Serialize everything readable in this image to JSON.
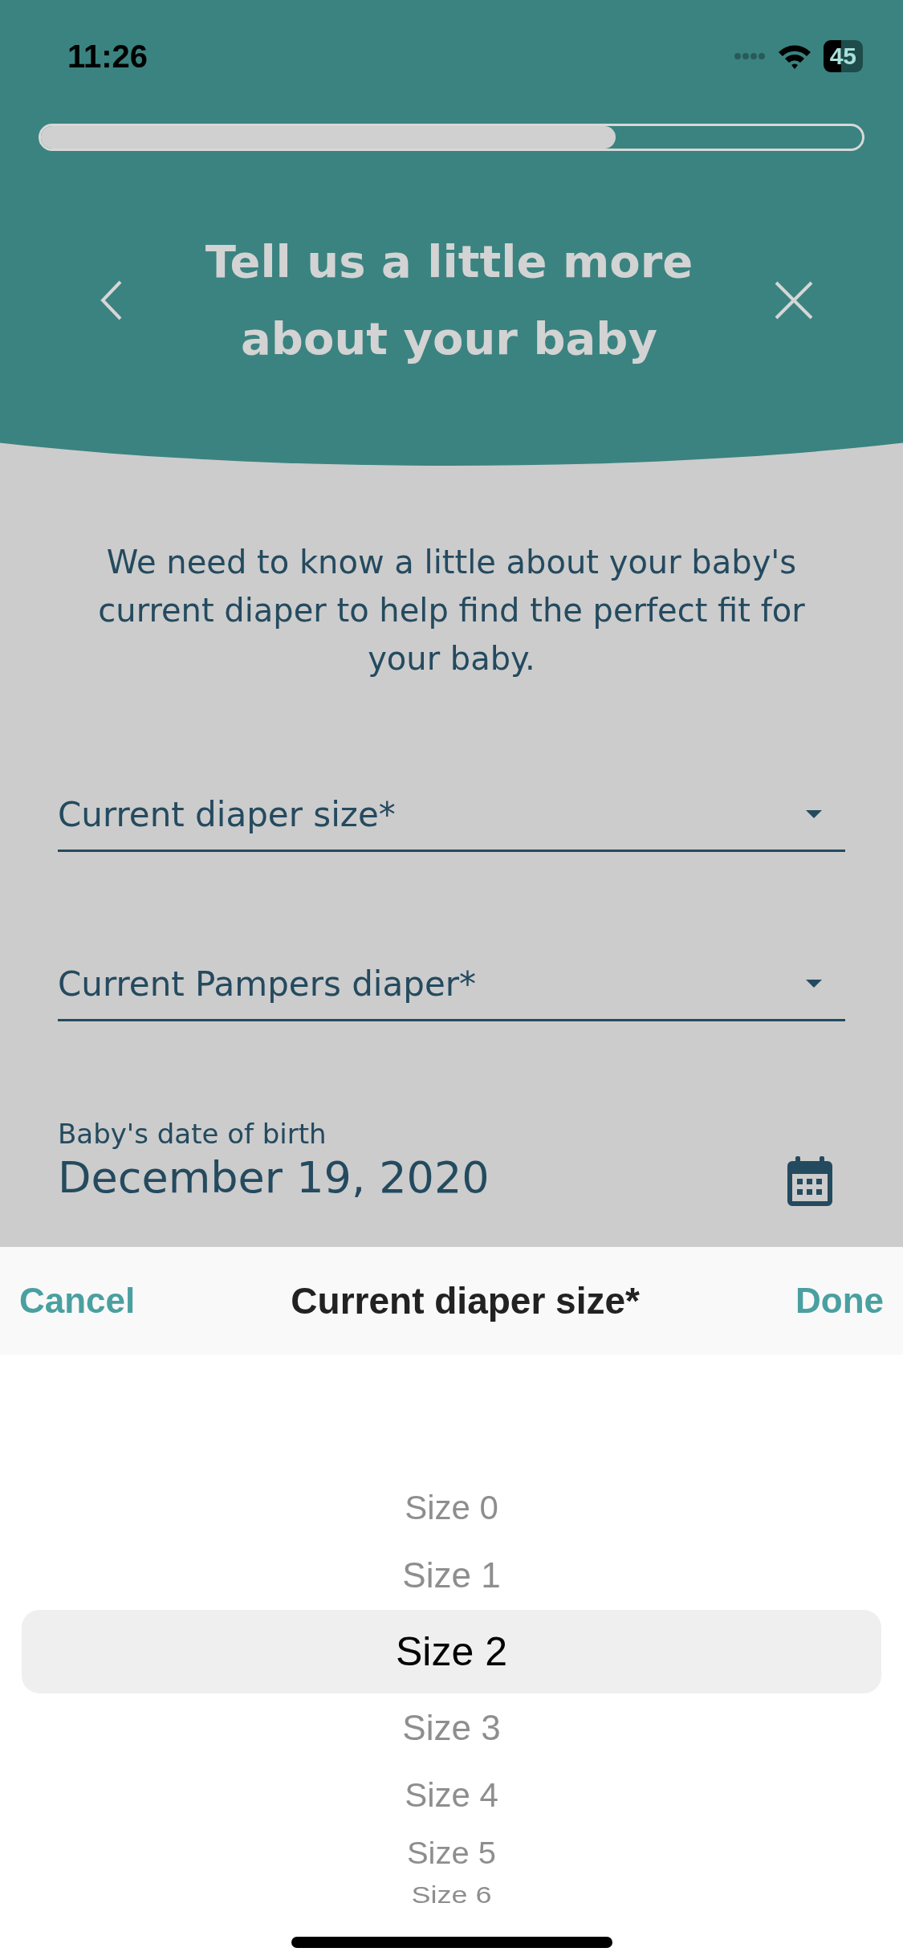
{
  "status_bar": {
    "time": "11:26",
    "battery": "45"
  },
  "progress": {
    "level": 0.7
  },
  "header": {
    "title_lines": [
      "Tell us a little more",
      "about your baby"
    ]
  },
  "intro": "We need to know a little about your baby's current diaper to help find the perfect fit for your baby.",
  "fields": [
    {
      "kind": "dropdown",
      "placeholder": "Current diaper size*"
    },
    {
      "kind": "dropdown",
      "placeholder": "Current Pampers diaper*"
    },
    {
      "kind": "date",
      "label": "Baby's date of birth",
      "value": "December 19, 2020"
    }
  ],
  "picker_sheet": {
    "cancel": "Cancel",
    "title": "Current diaper size*",
    "done": "Done",
    "options": [
      {
        "label": "Size 0",
        "selected": false
      },
      {
        "label": "Size 1",
        "selected": false
      },
      {
        "label": "Size 2",
        "selected": true
      },
      {
        "label": "Size 3",
        "selected": false
      },
      {
        "label": "Size 4",
        "selected": false
      },
      {
        "label": "Size 5",
        "selected": false
      },
      {
        "label": "Size 6",
        "selected": false
      }
    ]
  }
}
